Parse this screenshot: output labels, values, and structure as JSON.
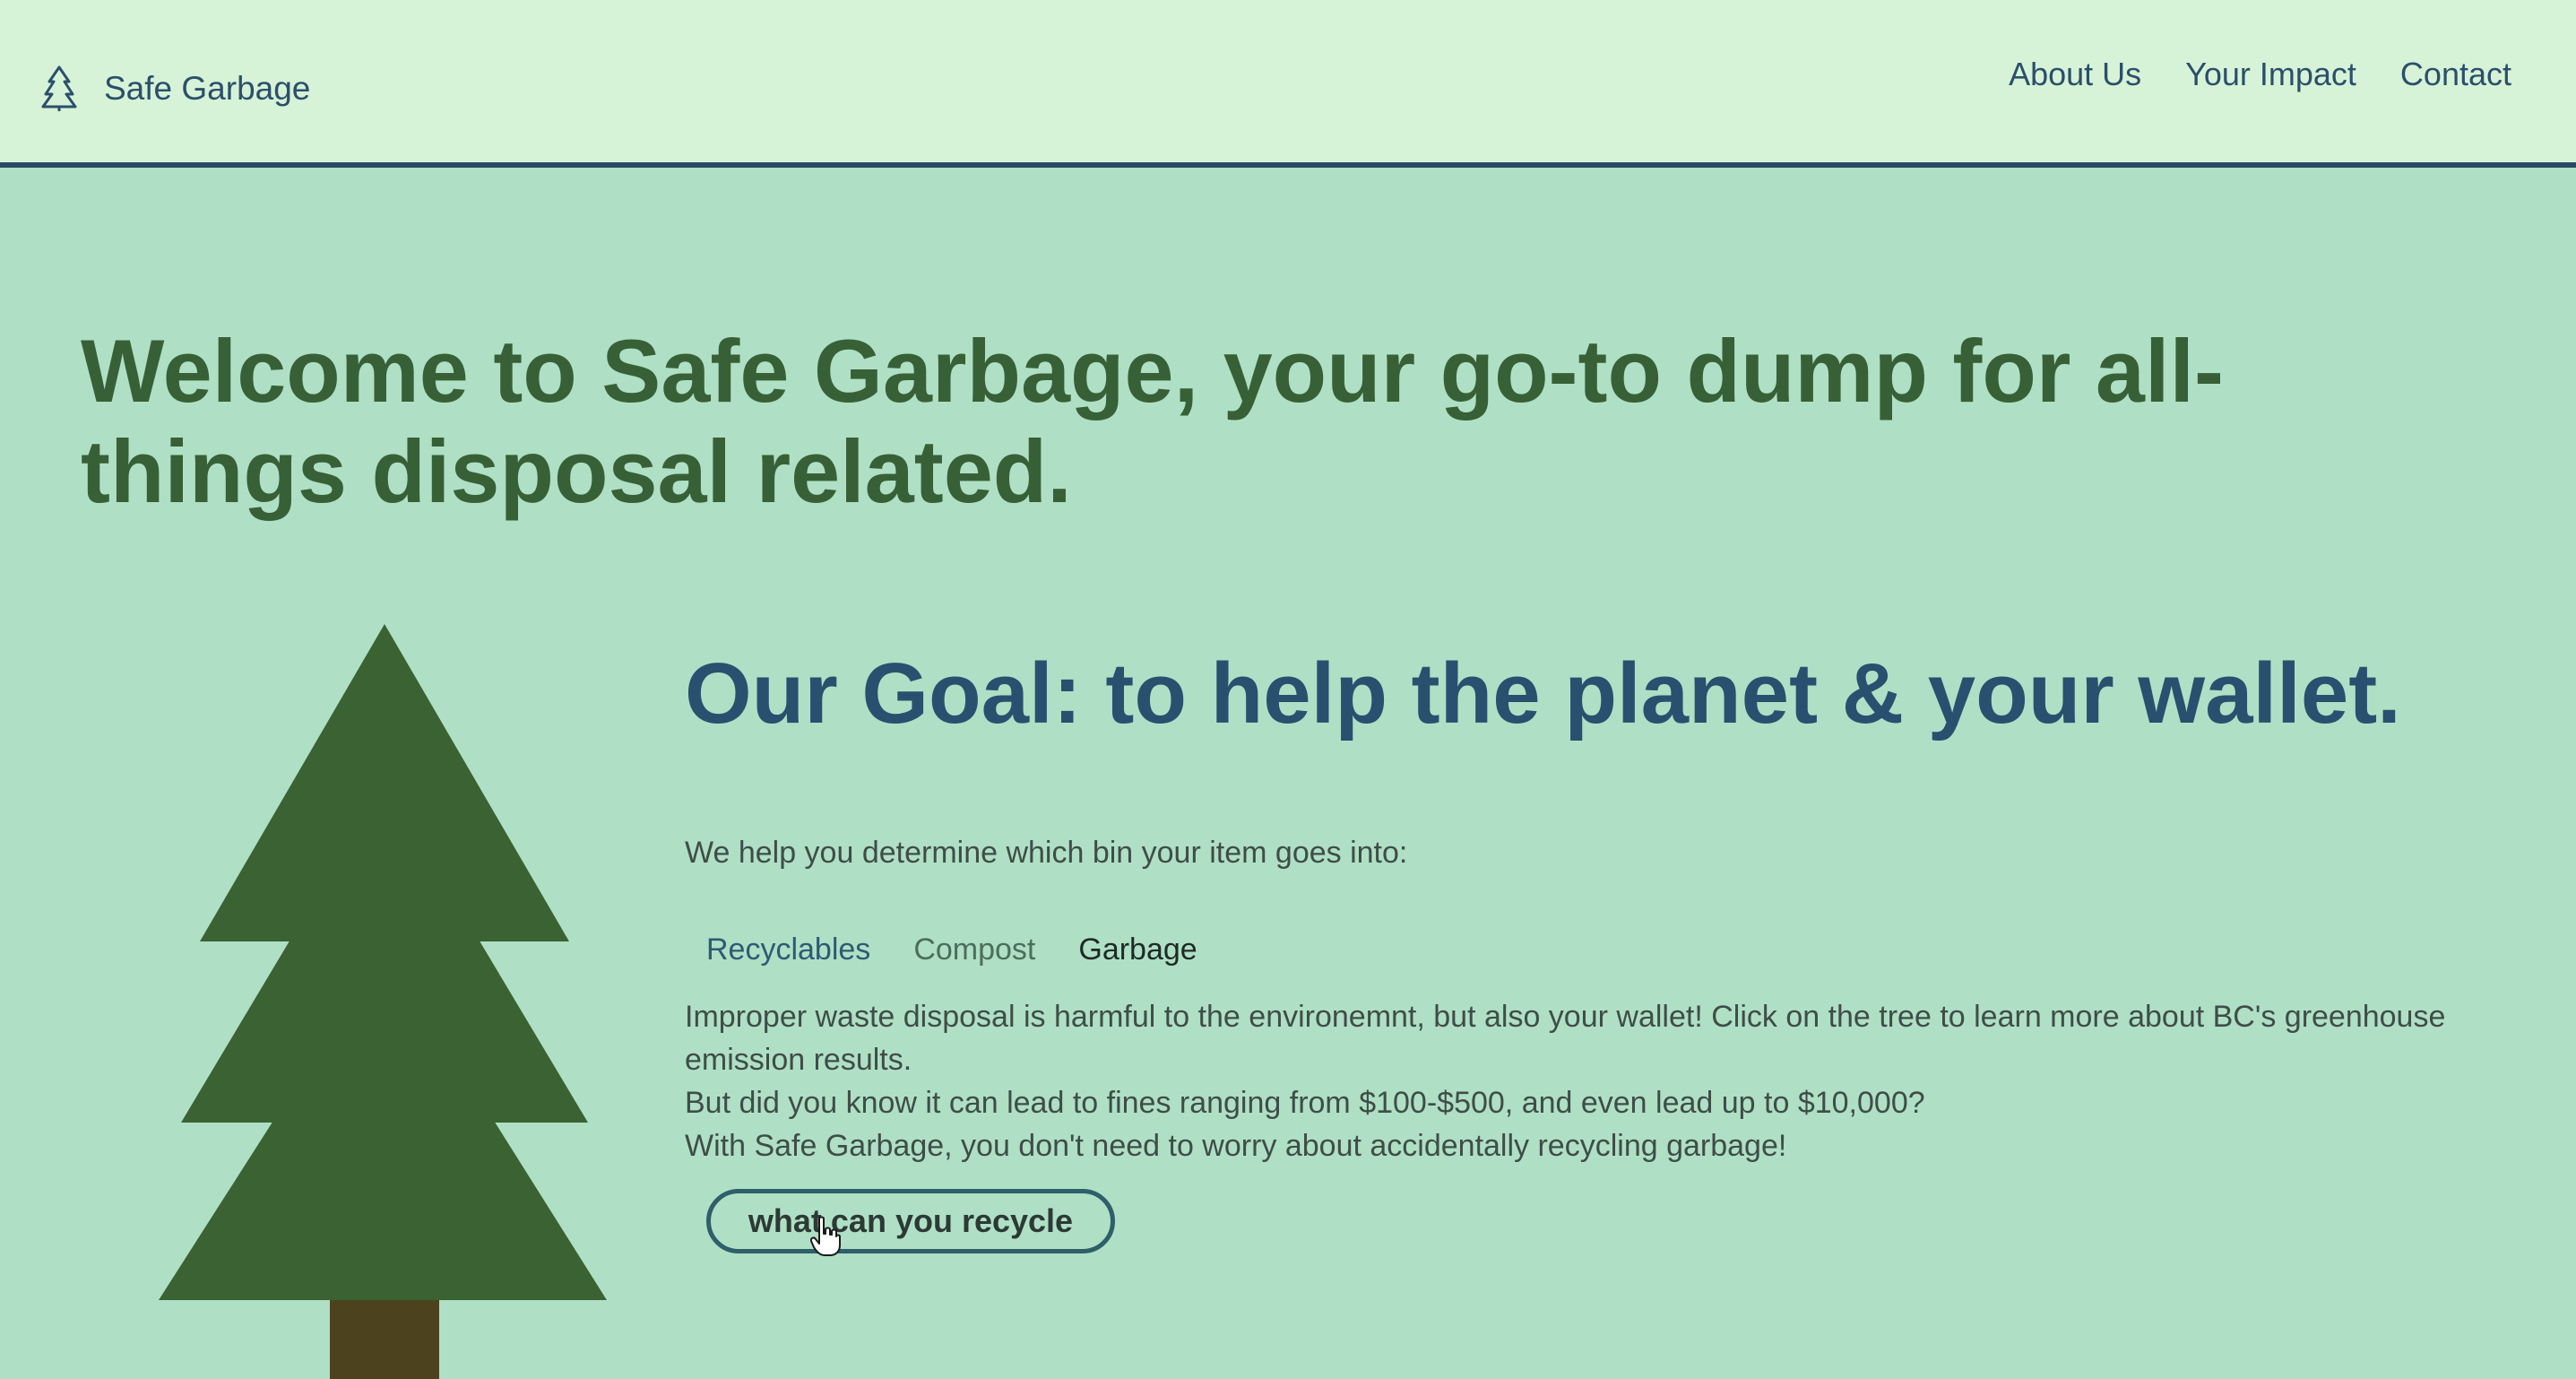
{
  "colors": {
    "header_bg": "#d7f3d7",
    "page_bg": "#afe0c5",
    "header_border": "#2a4a63",
    "hero_text": "#386036",
    "goal_text": "#29506e",
    "tree_green": "#3a6232",
    "trunk_brown": "#4c431e"
  },
  "header": {
    "logo_icon": "pine-tree-icon",
    "brand": "Safe Garbage",
    "nav": [
      {
        "label": "About Us"
      },
      {
        "label": "Your Impact"
      },
      {
        "label": "Contact"
      }
    ]
  },
  "hero": {
    "title": "Welcome to Safe Garbage, your go-to dump for all-things disposal related."
  },
  "goal": {
    "title": "Our Goal: to help the planet & your wallet.",
    "intro": "We help you determine which bin your item goes into:",
    "tabs": [
      {
        "label": "Recyclables"
      },
      {
        "label": "Compost"
      },
      {
        "label": "Garbage"
      }
    ],
    "selected_tab": "Garbage",
    "lines": [
      "Improper waste disposal is harmful to the environemnt, but also your wallet! Click on the tree to learn more about BC's greenhouse emission results.",
      "But did you know it can lead to fines ranging from $100-$500, and even lead up to $10,000?",
      "With Safe Garbage, you don't need to worry about accidentally recycling garbage!"
    ],
    "button_label": "what can you recycle"
  }
}
